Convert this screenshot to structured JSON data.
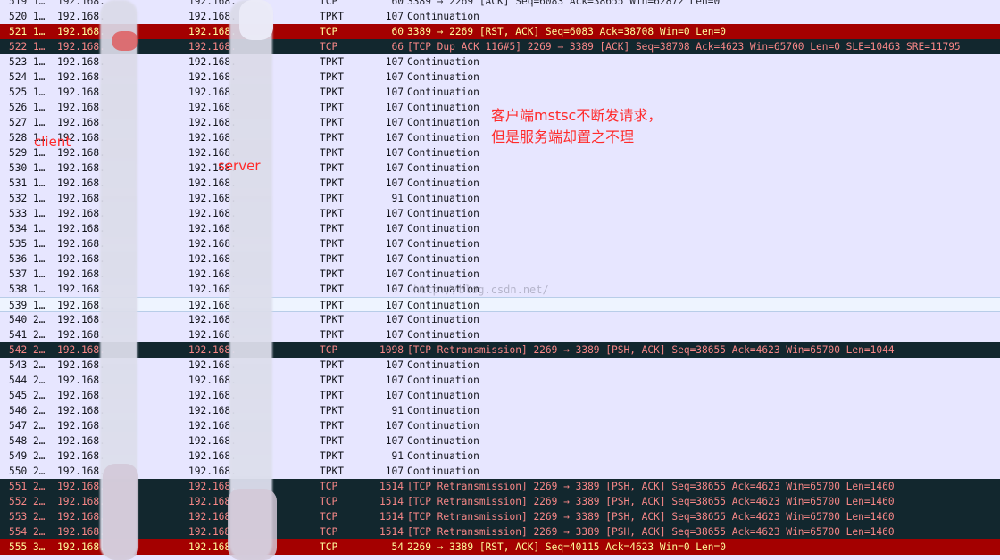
{
  "packets": [
    {
      "no": "519 1…",
      "src": "192.168.",
      "dst": "192.168.",
      "proto": "TCP",
      "len": "60",
      "info": "3389 → 2269 [ACK] Seq=6083 Ack=38655 Win=62872 Len=0",
      "style": "partial"
    },
    {
      "no": "520 1…",
      "src": "192.168.",
      "dst": "192.168.",
      "proto": "TPKT",
      "len": "107",
      "info": "Continuation",
      "style": "tpkt"
    },
    {
      "no": "521 1…",
      "src": "192.168.",
      "dst": "192.168.",
      "proto": "TCP",
      "len": "60",
      "info": "3389 → 2269 [RST, ACK] Seq=6083 Ack=38708 Win=0 Len=0",
      "style": "rst"
    },
    {
      "no": "522 1…",
      "src": "192.168.",
      "dst": "192.168.",
      "proto": "TCP",
      "len": "66",
      "info": "[TCP Dup ACK 116#5] 2269 → 3389 [ACK] Seq=38708 Ack=4623 Win=65700 Len=0 SLE=10463 SRE=11795",
      "style": "bad"
    },
    {
      "no": "523 1…",
      "src": "192.168.",
      "dst": "192.168.",
      "proto": "TPKT",
      "len": "107",
      "info": "Continuation",
      "style": "tpkt"
    },
    {
      "no": "524 1…",
      "src": "192.168.",
      "dst": "192.168.",
      "proto": "TPKT",
      "len": "107",
      "info": "Continuation",
      "style": "tpkt"
    },
    {
      "no": "525 1…",
      "src": "192.168.",
      "dst": "192.168.",
      "proto": "TPKT",
      "len": "107",
      "info": "Continuation",
      "style": "tpkt"
    },
    {
      "no": "526 1…",
      "src": "192.168.",
      "dst": "192.168.",
      "proto": "TPKT",
      "len": "107",
      "info": "Continuation",
      "style": "tpkt"
    },
    {
      "no": "527 1…",
      "src": "192.168.",
      "dst": "192.168.",
      "proto": "TPKT",
      "len": "107",
      "info": "Continuation",
      "style": "tpkt"
    },
    {
      "no": "528 1…",
      "src": "192.168.",
      "dst": "192.168.",
      "proto": "TPKT",
      "len": "107",
      "info": "Continuation",
      "style": "tpkt"
    },
    {
      "no": "529 1…",
      "src": "192.168.",
      "dst": "192.168.",
      "proto": "TPKT",
      "len": "107",
      "info": "Continuation",
      "style": "tpkt"
    },
    {
      "no": "530 1…",
      "src": "192.168.",
      "dst": "192.168.",
      "proto": "TPKT",
      "len": "107",
      "info": "Continuation",
      "style": "tpkt"
    },
    {
      "no": "531 1…",
      "src": "192.168.",
      "dst": "192.168.",
      "proto": "TPKT",
      "len": "107",
      "info": "Continuation",
      "style": "tpkt"
    },
    {
      "no": "532 1…",
      "src": "192.168.",
      "dst": "192.168.",
      "proto": "TPKT",
      "len": "91",
      "info": "Continuation",
      "style": "tpkt"
    },
    {
      "no": "533 1…",
      "src": "192.168.",
      "dst": "192.168.",
      "proto": "TPKT",
      "len": "107",
      "info": "Continuation",
      "style": "tpkt"
    },
    {
      "no": "534 1…",
      "src": "192.168.",
      "dst": "192.168.",
      "proto": "TPKT",
      "len": "107",
      "info": "Continuation",
      "style": "tpkt"
    },
    {
      "no": "535 1…",
      "src": "192.168.",
      "dst": "192.168.",
      "proto": "TPKT",
      "len": "107",
      "info": "Continuation",
      "style": "tpkt"
    },
    {
      "no": "536 1…",
      "src": "192.168.",
      "dst": "192.168.",
      "proto": "TPKT",
      "len": "107",
      "info": "Continuation",
      "style": "tpkt"
    },
    {
      "no": "537 1…",
      "src": "192.168.",
      "dst": "192.168.",
      "proto": "TPKT",
      "len": "107",
      "info": "Continuation",
      "style": "tpkt"
    },
    {
      "no": "538 1…",
      "src": "192.168.",
      "dst": "192.168.",
      "proto": "TPKT",
      "len": "107",
      "info": "Continuation",
      "style": "tpkt"
    },
    {
      "no": "539 1…",
      "src": "192.168.",
      "dst": "192.168.",
      "proto": "TPKT",
      "len": "107",
      "info": "Continuation",
      "style": "selected-ghost"
    },
    {
      "no": "540 2…",
      "src": "192.168.",
      "dst": "192.168.",
      "proto": "TPKT",
      "len": "107",
      "info": "Continuation",
      "style": "tpkt"
    },
    {
      "no": "541 2…",
      "src": "192.168.",
      "dst": "192.168.",
      "proto": "TPKT",
      "len": "107",
      "info": "Continuation",
      "style": "tpkt"
    },
    {
      "no": "542 2…",
      "src": "192.168.",
      "dst": "192.168.",
      "proto": "TCP",
      "len": "1098",
      "info": "[TCP Retransmission] 2269 → 3389 [PSH, ACK] Seq=38655 Ack=4623 Win=65700 Len=1044",
      "style": "bad"
    },
    {
      "no": "543 2…",
      "src": "192.168.",
      "dst": "192.168.",
      "proto": "TPKT",
      "len": "107",
      "info": "Continuation",
      "style": "tpkt"
    },
    {
      "no": "544 2…",
      "src": "192.168.",
      "dst": "192.168.",
      "proto": "TPKT",
      "len": "107",
      "info": "Continuation",
      "style": "tpkt"
    },
    {
      "no": "545 2…",
      "src": "192.168.",
      "dst": "192.168.",
      "proto": "TPKT",
      "len": "107",
      "info": "Continuation",
      "style": "tpkt"
    },
    {
      "no": "546 2…",
      "src": "192.168.",
      "dst": "192.168.",
      "proto": "TPKT",
      "len": "91",
      "info": "Continuation",
      "style": "tpkt"
    },
    {
      "no": "547 2…",
      "src": "192.168.",
      "dst": "192.168.",
      "proto": "TPKT",
      "len": "107",
      "info": "Continuation",
      "style": "tpkt"
    },
    {
      "no": "548 2…",
      "src": "192.168.",
      "dst": "192.168.",
      "proto": "TPKT",
      "len": "107",
      "info": "Continuation",
      "style": "tpkt"
    },
    {
      "no": "549 2…",
      "src": "192.168.",
      "dst": "192.168.",
      "proto": "TPKT",
      "len": "91",
      "info": "Continuation",
      "style": "tpkt"
    },
    {
      "no": "550 2…",
      "src": "192.168.",
      "dst": "192.168.",
      "proto": "TPKT",
      "len": "107",
      "info": "Continuation",
      "style": "tpkt"
    },
    {
      "no": "551 2…",
      "src": "192.168.",
      "dst": "192.168.",
      "proto": "TCP",
      "len": "1514",
      "info": "[TCP Retransmission] 2269 → 3389 [PSH, ACK] Seq=38655 Ack=4623 Win=65700 Len=1460",
      "style": "bad"
    },
    {
      "no": "552 2…",
      "src": "192.168.",
      "dst": "192.168.",
      "proto": "TCP",
      "len": "1514",
      "info": "[TCP Retransmission] 2269 → 3389 [PSH, ACK] Seq=38655 Ack=4623 Win=65700 Len=1460",
      "style": "bad"
    },
    {
      "no": "553 2…",
      "src": "192.168.",
      "dst": "192.168.",
      "proto": "TCP",
      "len": "1514",
      "info": "[TCP Retransmission] 2269 → 3389 [PSH, ACK] Seq=38655 Ack=4623 Win=65700 Len=1460",
      "style": "bad"
    },
    {
      "no": "554 2…",
      "src": "192.168.",
      "dst": "192.168.",
      "proto": "TCP",
      "len": "1514",
      "info": "[TCP Retransmission] 2269 → 3389 [PSH, ACK] Seq=38655 Ack=4623 Win=65700 Len=1460",
      "style": "bad"
    },
    {
      "no": "555 3…",
      "src": "192.168.",
      "dst": "192.168.",
      "proto": "TCP",
      "len": "54",
      "info": "2269 → 3389 [RST, ACK] Seq=40115 Ack=4623 Win=0 Len=0",
      "style": "rst"
    }
  ],
  "annotations": {
    "client": "client",
    "server": "server",
    "note_line_1": "客户端mstsc不断发请求，",
    "note_line_2": "但是服务端却置之不理"
  },
  "watermark": "http://blog.csdn.net/",
  "colors": {
    "background": "#e7e6ff",
    "rst_background": "#a40000",
    "rst_text": "#fffc9c",
    "bad_background": "#12272e",
    "bad_text": "#f78787",
    "annotation": "#ff2b2b"
  }
}
